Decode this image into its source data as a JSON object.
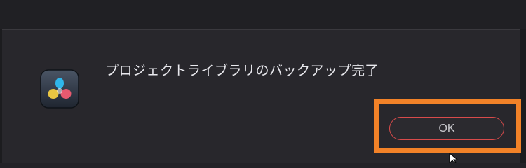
{
  "dialog": {
    "message": "プロジェクトライブラリのバックアップ完了",
    "ok_label": "OK"
  },
  "icons": {
    "app": "davinci-resolve-icon",
    "cursor": "mouse-pointer-icon"
  },
  "colors": {
    "highlight": "#f28228",
    "button_border": "#d94b4b",
    "background": "#28272c"
  }
}
